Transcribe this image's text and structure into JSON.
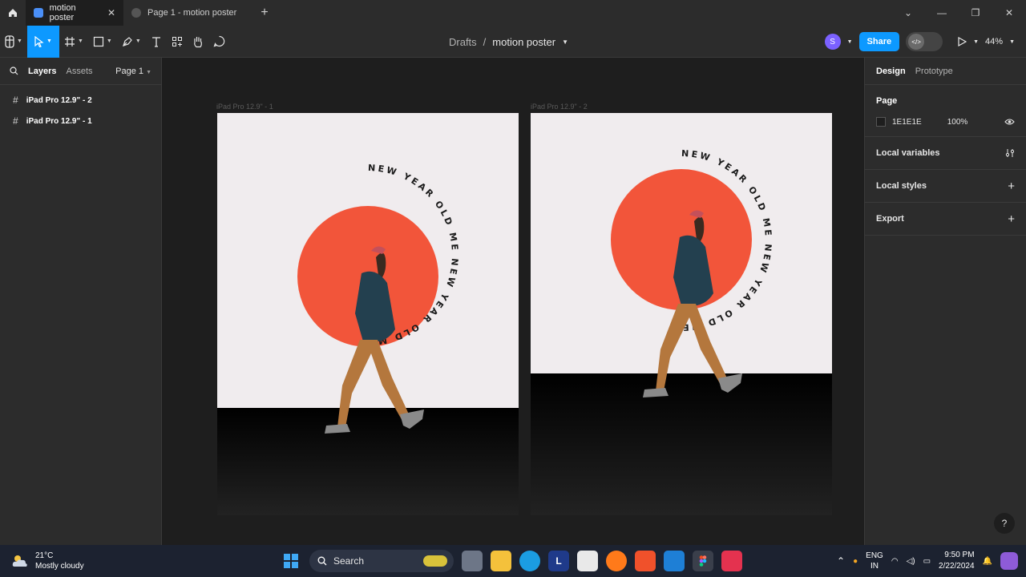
{
  "titlebar": {
    "tabs": [
      {
        "label": "motion poster",
        "active": true
      },
      {
        "label": "Page 1 - motion poster",
        "active": false
      }
    ]
  },
  "toolbar": {
    "breadcrumb_root": "Drafts",
    "breadcrumb_sep": "/",
    "file_name": "motion poster",
    "avatar_initial": "S",
    "share_label": "Share",
    "zoom": "44%"
  },
  "left_panel": {
    "tab_layers": "Layers",
    "tab_assets": "Assets",
    "page_selector": "Page 1",
    "layers": [
      "iPad Pro 12.9\" - 2",
      "iPad Pro 12.9\" - 1"
    ]
  },
  "canvas": {
    "frames": [
      {
        "label": "iPad Pro 12.9\" - 1"
      },
      {
        "label": "iPad Pro 12.9\" - 2"
      }
    ],
    "poster_text": "NEW YEAR OLD ME  NEW YEAR OLD ME  "
  },
  "right_panel": {
    "tab_design": "Design",
    "tab_prototype": "Prototype",
    "page_title": "Page",
    "page_color": "1E1E1E",
    "page_opacity": "100%",
    "local_variables": "Local variables",
    "local_styles": "Local styles",
    "export": "Export",
    "help": "?"
  },
  "taskbar": {
    "temp": "21°C",
    "weather": "Mostly cloudy",
    "search": "Search",
    "lang": "ENG",
    "region": "IN",
    "time": "9:50 PM",
    "date": "2/22/2024"
  },
  "colors": {
    "accent": "#0d99ff",
    "poster_bg": "#f0ecee",
    "sun": "#f2553a"
  }
}
